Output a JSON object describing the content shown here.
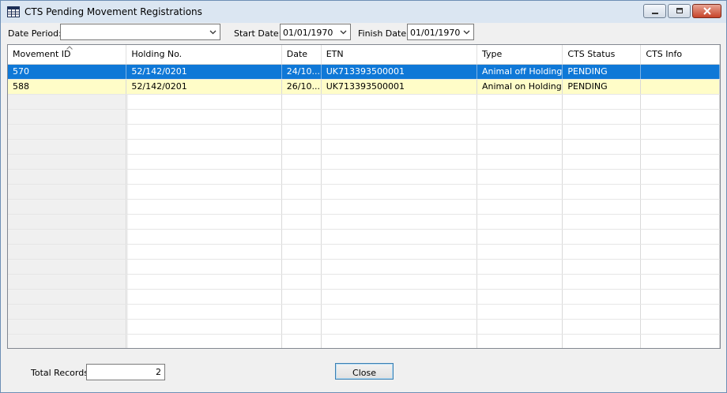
{
  "window": {
    "title": "CTS Pending Movement Registrations"
  },
  "filters": {
    "date_period_label": "Date Period:",
    "date_period_value": "",
    "start_date_label": "Start Date:",
    "start_date_value": "01/01/1970",
    "finish_date_label": "Finish Date:",
    "finish_date_value": "01/01/1970"
  },
  "grid": {
    "columns": [
      "Movement ID",
      "Holding No.",
      "Date",
      "ETN",
      "Type",
      "CTS Status",
      "CTS Info"
    ],
    "sorted_column": "Movement ID",
    "rows": [
      {
        "movement_id": "570",
        "holding_no": "52/142/0201",
        "date": "24/10...",
        "etn": "UK713393500001",
        "type": "Animal off Holding",
        "cts_status": "PENDING",
        "cts_info": "",
        "selected": true
      },
      {
        "movement_id": "588",
        "holding_no": "52/142/0201",
        "date": "26/10...",
        "etn": "UK713393500001",
        "type": "Animal on Holding",
        "cts_status": "PENDING",
        "cts_info": "",
        "selected": false
      }
    ]
  },
  "footer": {
    "total_records_label": "Total Records:",
    "total_records_value": "2",
    "close_label": "Close"
  },
  "colors": {
    "selection": "#0f78d7",
    "alt_row": "#fffdc8"
  }
}
